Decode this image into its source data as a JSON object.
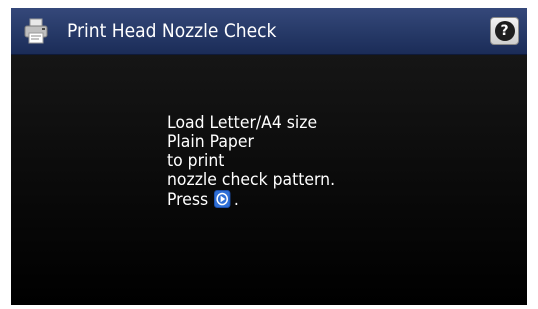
{
  "header": {
    "title": "Print Head Nozzle Check",
    "icon": "printer-icon",
    "help_button_label": "?"
  },
  "message": {
    "lines": [
      "Load Letter/A4 size",
      "Plain Paper",
      "to print",
      "nozzle check pattern."
    ],
    "press_prefix": "Press",
    "press_icon": "start-button-icon",
    "press_suffix": "."
  },
  "colors": {
    "titlebar": "#263967",
    "background": "#0e0e0e",
    "text": "#ffffff",
    "start_icon": "#2f6fd6"
  }
}
